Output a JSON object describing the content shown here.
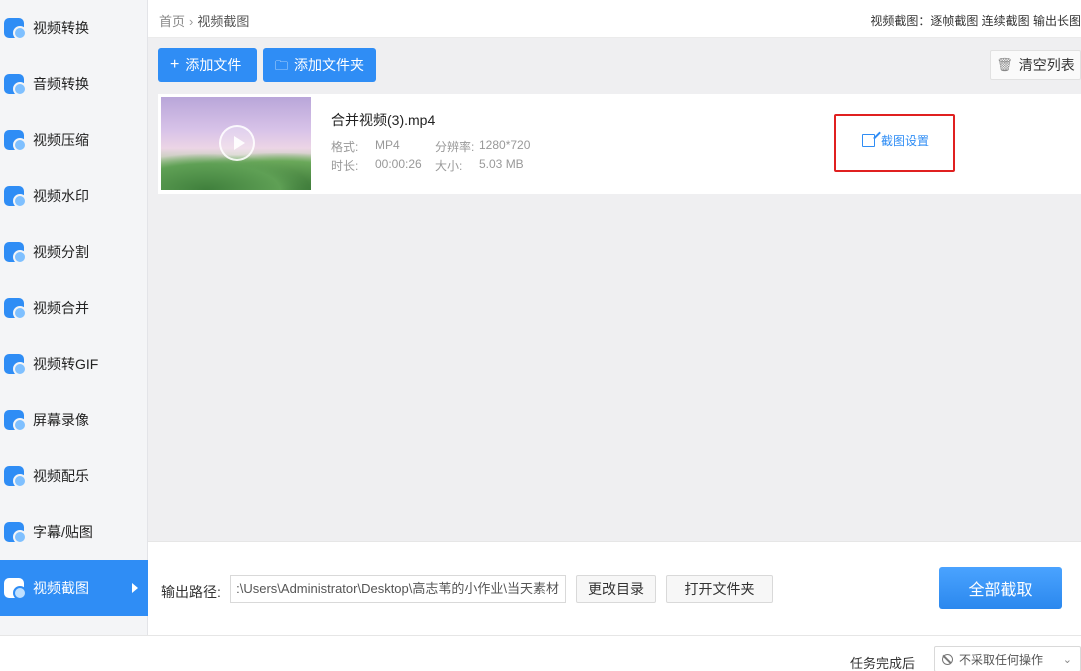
{
  "sidebar": {
    "items": [
      {
        "label": "视频转换",
        "icon": "video-convert-icon"
      },
      {
        "label": "音频转换",
        "icon": "audio-convert-icon"
      },
      {
        "label": "视频压缩",
        "icon": "video-compress-icon"
      },
      {
        "label": "视频水印",
        "icon": "video-watermark-icon"
      },
      {
        "label": "视频分割",
        "icon": "video-split-icon"
      },
      {
        "label": "视频合并",
        "icon": "video-merge-icon"
      },
      {
        "label": "视频转GIF",
        "icon": "video-gif-icon"
      },
      {
        "label": "屏幕录像",
        "icon": "screen-record-icon"
      },
      {
        "label": "视频配乐",
        "icon": "video-music-icon"
      },
      {
        "label": "字幕/贴图",
        "icon": "subtitle-sticker-icon"
      },
      {
        "label": "视频截图",
        "icon": "video-screenshot-icon",
        "active": true
      }
    ]
  },
  "header": {
    "breadcrumb_home": "首页",
    "breadcrumb_sep": "›",
    "breadcrumb_current": "视频截图",
    "right_text": "视频截图：逐帧截图 连续截图 输出长图"
  },
  "toolbar": {
    "add_file": "添加文件",
    "add_folder": "添加文件夹",
    "clear_list": "清空列表"
  },
  "file": {
    "name": "合并视频(3).mp4",
    "format_label": "格式:",
    "format_value": "MP4",
    "resolution_label": "分辨率:",
    "resolution_value": "1280*720",
    "duration_label": "时长:",
    "duration_value": "00:00:26",
    "size_label": "大小:",
    "size_value": "5.03 MB",
    "settings_label": "截图设置"
  },
  "output": {
    "label": "输出路径:",
    "path": ":\\Users\\Administrator\\Desktop\\高志苇的小作业\\当天素材",
    "change_dir": "更改目录",
    "open_folder": "打开文件夹",
    "start_all": "全部截取"
  },
  "status": {
    "after_label": "任务完成后",
    "after_value": "不采取任何操作"
  },
  "colors": {
    "accent": "#2f8df5",
    "highlight": "#e02020"
  }
}
